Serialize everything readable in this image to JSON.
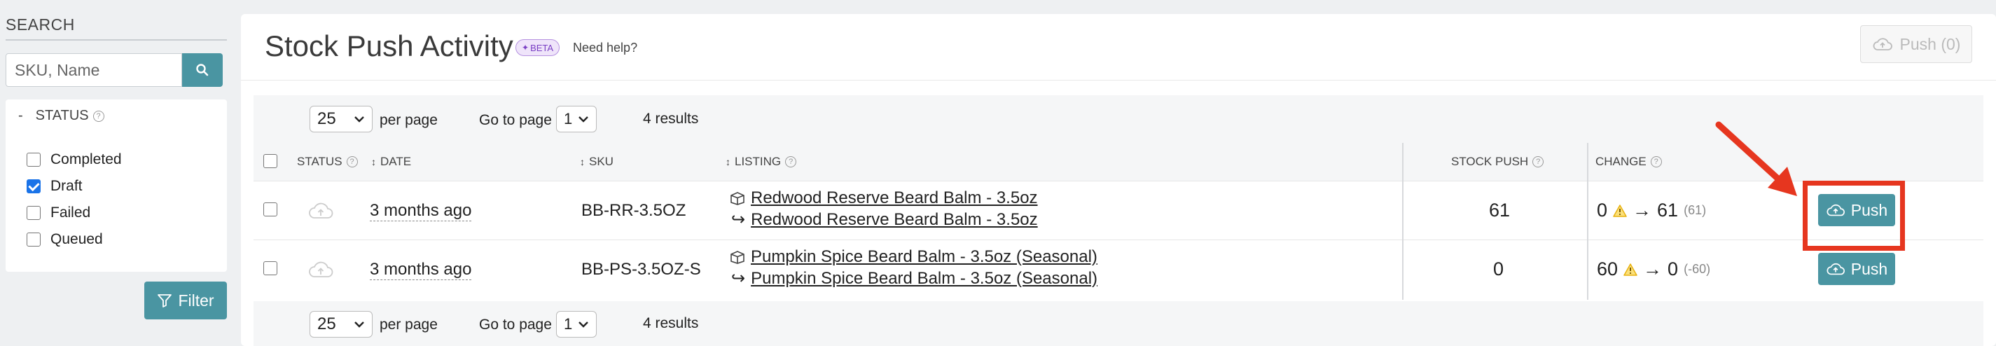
{
  "sidebar": {
    "search_title": "SEARCH",
    "search_placeholder": "SKU, Name",
    "status_label": "STATUS",
    "status_dash": "-",
    "filters": [
      {
        "label": "Completed",
        "checked": false
      },
      {
        "label": "Draft",
        "checked": true
      },
      {
        "label": "Failed",
        "checked": false
      },
      {
        "label": "Queued",
        "checked": false
      }
    ],
    "filter_button": "Filter"
  },
  "header": {
    "title": "Stock Push Activity",
    "beta_badge": "BETA",
    "need_help": "Need help?",
    "push_all_button": "Push (0)"
  },
  "pagination": {
    "per_page_value": "25",
    "per_page_label": "per page",
    "go_to_page_label": "Go to page",
    "page_value": "1",
    "results": "4 results"
  },
  "table": {
    "columns": {
      "status": "STATUS",
      "date": "DATE",
      "sku": "SKU",
      "listing": "LISTING",
      "stock_push": "STOCK PUSH",
      "change": "CHANGE"
    },
    "rows": [
      {
        "date": "3 months ago",
        "sku": "BB-RR-3.5OZ",
        "listing_primary": "Redwood Reserve Beard Balm - 3.5oz",
        "listing_secondary": "Redwood Reserve Beard Balm - 3.5oz",
        "stock_push": "61",
        "change_from": "0",
        "change_to": "61",
        "change_diff": "(61)",
        "push_label": "Push"
      },
      {
        "date": "3 months ago",
        "sku": "BB-PS-3.5OZ-S",
        "listing_primary": "Pumpkin Spice Beard Balm - 3.5oz (Seasonal)",
        "listing_secondary": "Pumpkin Spice Beard Balm - 3.5oz (Seasonal)",
        "stock_push": "0",
        "change_from": "60",
        "change_to": "0",
        "change_diff": "(-60)",
        "push_label": "Push"
      }
    ]
  },
  "glyphs": {
    "arrow_right": "→",
    "reply_arrow": "↪",
    "help": "?",
    "sort": "↕"
  },
  "icons": [
    "search-icon",
    "funnel-icon",
    "cloud-upload-icon",
    "box-icon",
    "warning-icon",
    "chevron-down-icon",
    "help-icon",
    "sparkle-icon"
  ],
  "colors": {
    "teal": "#4a95a2",
    "highlight_red": "#e6361f",
    "warning": "#e8b10f",
    "beta_purple": "#7a3fc4"
  }
}
